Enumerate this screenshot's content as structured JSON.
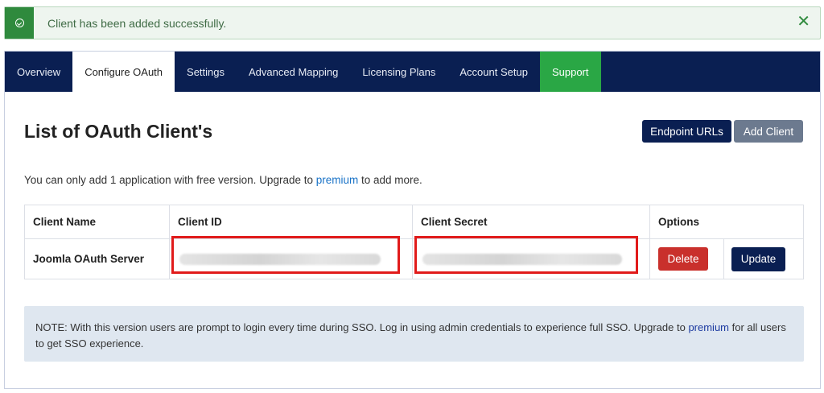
{
  "alert": {
    "message": "Client has been added successfully.",
    "close": "✕",
    "icon": "check-circle-icon",
    "color": "#2f8a3d"
  },
  "tabs": [
    {
      "label": "Overview"
    },
    {
      "label": "Configure OAuth"
    },
    {
      "label": "Settings"
    },
    {
      "label": "Advanced Mapping"
    },
    {
      "label": "Licensing Plans"
    },
    {
      "label": "Account Setup"
    },
    {
      "label": "Support"
    }
  ],
  "header": {
    "title": "List of OAuth Client's",
    "endpoint_button": "Endpoint URLs",
    "add_button": "Add Client"
  },
  "info": {
    "before": "You can only add 1 application with free version. Upgrade to ",
    "link": "premium",
    "after": " to add more."
  },
  "table": {
    "columns": [
      "Client Name",
      "Client ID",
      "Client Secret",
      "Options"
    ],
    "rows": [
      {
        "client_name": "Joomla OAuth Server",
        "delete": "Delete",
        "update": "Update"
      }
    ]
  },
  "note": {
    "before": "NOTE: With this version users are prompt to login every time during SSO. Log in using admin credentials to experience full SSO. Upgrade to ",
    "link": "premium",
    "after": " for all users to get SSO experience."
  },
  "colors": {
    "navy": "#0a1f52",
    "support_green": "#2aa745",
    "delete_red": "#c9302c",
    "highlight_red": "#e11b1b"
  }
}
